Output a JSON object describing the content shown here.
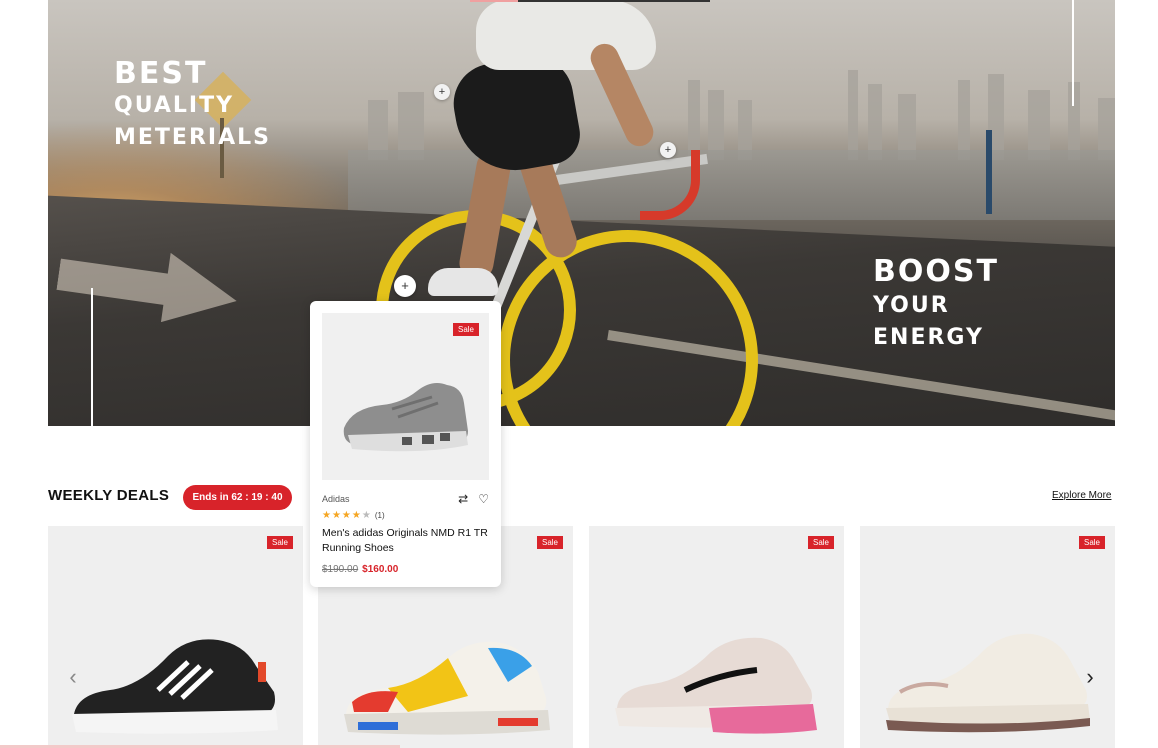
{
  "hero": {
    "left_heading": "BEST",
    "left_line2": "QUALITY",
    "left_line3": "METERIALS",
    "right_heading": "BOOST",
    "right_line2": "YOUR",
    "right_line3": "ENERGY",
    "hotspot_symbol": "+"
  },
  "popup": {
    "sale_badge": "Sale",
    "brand": "Adidas",
    "compare_icon": "⇄",
    "wishlist_icon": "♡",
    "stars_filled": "★★★★",
    "stars_empty": "★",
    "rating_count": "(1)",
    "rating": 4,
    "title": "Men's adidas Originals NMD R1 TR Running Shoes",
    "old_price": "$190.00",
    "new_price": "$160.00"
  },
  "deals": {
    "title": "WEEKLY DEALS",
    "timer": "Ends in 62 : 19 : 40",
    "explore_label": "Explore More",
    "prev_arrow": "‹",
    "next_arrow": "›",
    "cards": [
      {
        "sale": "Sale",
        "shoe_color": "#222222",
        "accent": "#ffffff"
      },
      {
        "sale": "Sale",
        "shoe_color": "#f4f1ea",
        "accent": "#f2c416"
      },
      {
        "sale": "Sale",
        "shoe_color": "#e7dbd5",
        "accent": "#e76a9b"
      },
      {
        "sale": "Sale",
        "shoe_color": "#f1ece3",
        "accent": "#7a5a52"
      }
    ]
  },
  "colors": {
    "accent_red": "#d8232a",
    "star_gold": "#f5a623"
  }
}
